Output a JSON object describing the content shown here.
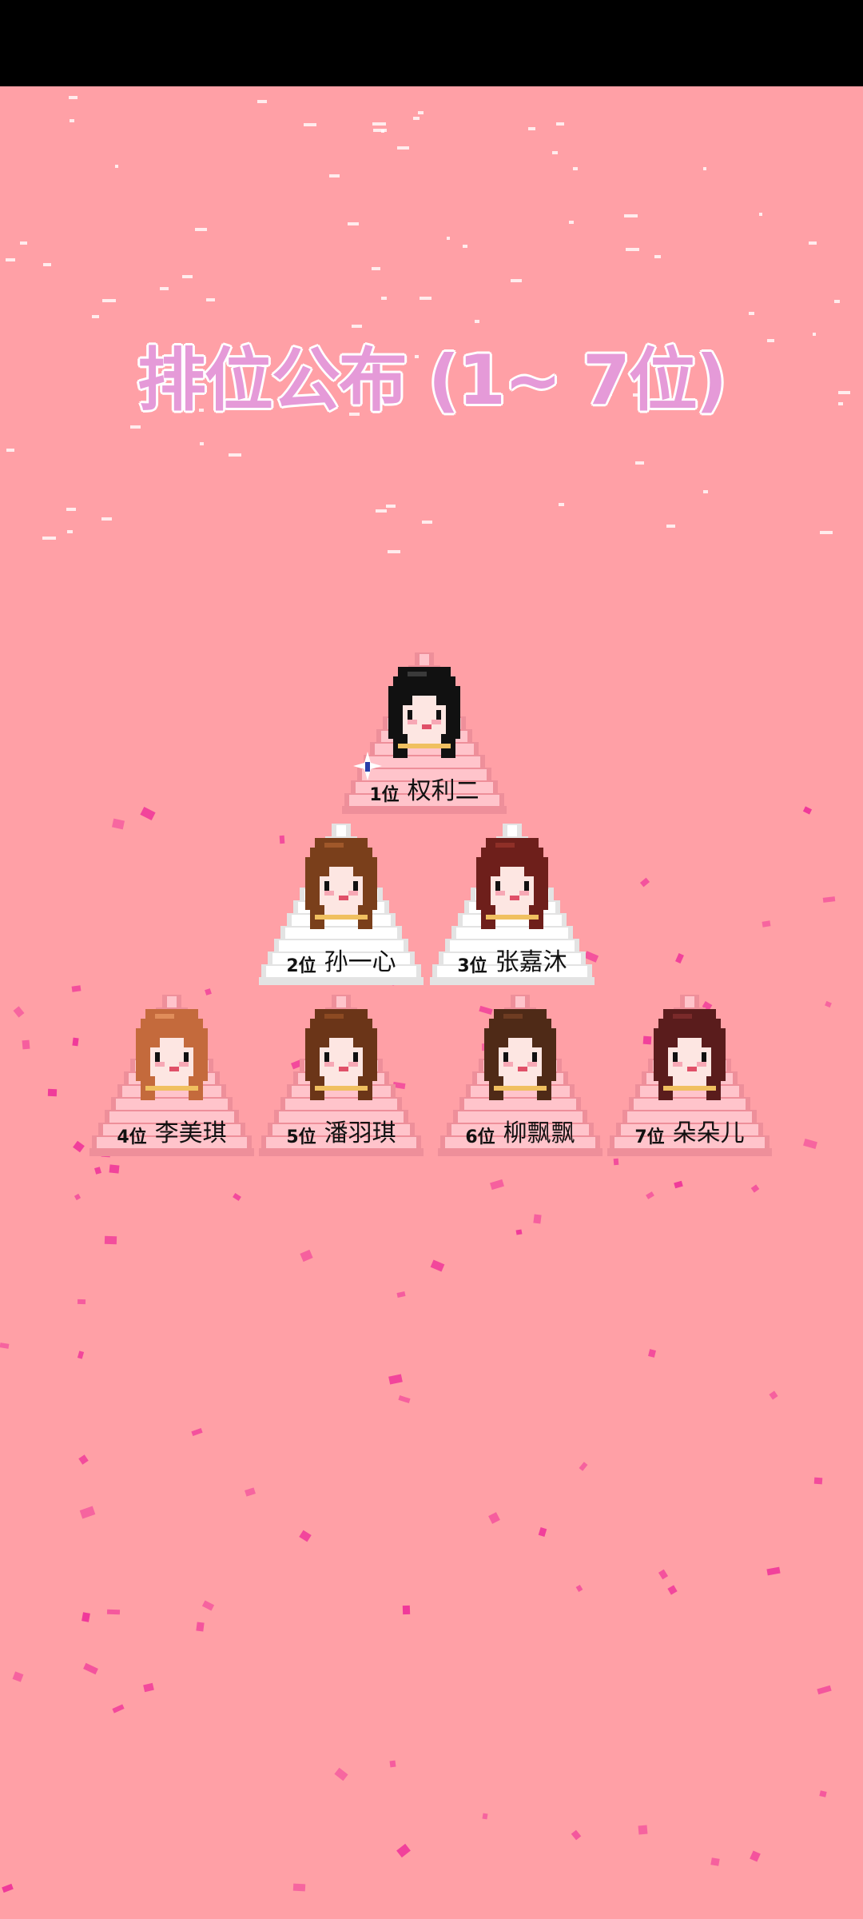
{
  "screen": {
    "title": "排位公布 (1~ 7位)",
    "background_color": "#ffa0a6",
    "title_color": "#e59ad8",
    "accent_confetti": "#f0389a"
  },
  "ranking": [
    {
      "rank": "1位",
      "name": "权利二",
      "hair": "#111111",
      "hair_light": "#3a3a3a",
      "tile": "pink",
      "badge": "sparkle-icon"
    },
    {
      "rank": "2位",
      "name": "孙一心",
      "hair": "#7a3f1b",
      "hair_light": "#a0582a",
      "tile": "white"
    },
    {
      "rank": "3位",
      "name": "张嘉沐",
      "hair": "#6e1f1b",
      "hair_light": "#8f2f27",
      "tile": "white"
    },
    {
      "rank": "4位",
      "name": "李美琪",
      "hair": "#c46a3c",
      "hair_light": "#e08d5a",
      "tile": "pink"
    },
    {
      "rank": "5位",
      "name": "潘羽琪",
      "hair": "#6b3518",
      "hair_light": "#8c4a22",
      "tile": "pink"
    },
    {
      "rank": "6位",
      "name": "柳飘飘",
      "hair": "#4f2a17",
      "hair_light": "#6e3c22",
      "tile": "pink"
    },
    {
      "rank": "7位",
      "name": "朵朵儿",
      "hair": "#5a1c1c",
      "hair_light": "#7a2a2a",
      "tile": "pink"
    }
  ]
}
